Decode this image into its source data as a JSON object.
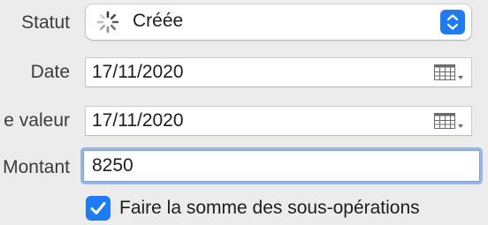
{
  "form": {
    "status": {
      "label": "Statut",
      "value": "Créée",
      "icon": "spinner-icon"
    },
    "date": {
      "label": "Date",
      "value": "17/11/2020"
    },
    "value_date": {
      "label": "e valeur",
      "value": "17/11/2020"
    },
    "amount": {
      "label": "Montant",
      "value": "8250"
    },
    "sum_suboperations": {
      "label": "Faire la somme des sous-opérations",
      "checked": true
    }
  },
  "colors": {
    "accent": "#1e7bf6",
    "focus_ring": "#548be3",
    "background": "#ececec"
  }
}
